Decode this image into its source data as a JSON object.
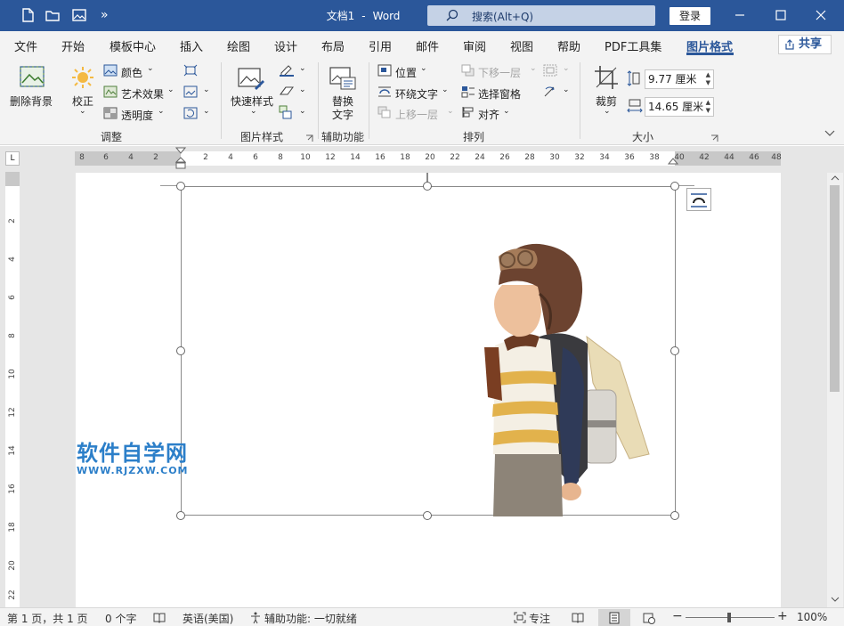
{
  "titlebar": {
    "doc_name": "文档1",
    "separator": "-",
    "app_name": "Word",
    "search_label": "搜索(Alt+Q)",
    "login_label": "登录",
    "qat_more": "»"
  },
  "menu": {
    "tabs": [
      "文件",
      "开始",
      "模板中心",
      "插入",
      "绘图",
      "设计",
      "布局",
      "引用",
      "邮件",
      "审阅",
      "视图",
      "帮助",
      "PDF工具集",
      "图片格式"
    ],
    "active_tab": "图片格式",
    "share_label": "共享"
  },
  "ribbon": {
    "adjust": {
      "remove_bg": "删除背景",
      "correct": "校正",
      "color": "颜色",
      "artistic": "艺术效果",
      "transparency": "透明度",
      "group_label": "调整"
    },
    "styles": {
      "quick_styles": "快速样式",
      "group_label": "图片样式"
    },
    "accessibility": {
      "alt_text_line1": "替换",
      "alt_text_line2": "文字",
      "group_label": "辅助功能"
    },
    "arrange": {
      "position": "位置",
      "wrap_text": "环绕文字",
      "bring_forward": "上移一层",
      "send_backward": "下移一层",
      "selection_pane": "选择窗格",
      "align": "对齐",
      "group_label": "排列"
    },
    "size": {
      "crop": "裁剪",
      "height": "9.77 厘米",
      "width": "14.65 厘米",
      "group_label": "大小"
    }
  },
  "ruler": {
    "h_numbers": [
      "8",
      "6",
      "4",
      "2",
      "",
      "2",
      "4",
      "6",
      "8",
      "10",
      "12",
      "14",
      "16",
      "18",
      "20",
      "22",
      "24",
      "26",
      "28",
      "30",
      "32",
      "34",
      "36",
      "38",
      "40",
      "42",
      "44",
      "46",
      "48"
    ],
    "v_numbers": [
      "2",
      "4",
      "6",
      "8",
      "10",
      "12",
      "14",
      "16",
      "18",
      "20",
      "22"
    ],
    "corner": "L"
  },
  "watermark": {
    "title": "软件自学网",
    "url": "WWW.RJZXW.COM"
  },
  "statusbar": {
    "pages": "第 1 页，共 1 页",
    "words": "0 个字",
    "language": "英语(美国)",
    "accessibility": "辅助功能: 一切就绪",
    "focus": "专注",
    "zoom_minus": "−",
    "zoom_plus": "+",
    "zoom": "100%"
  },
  "colors": {
    "title_bar": "#2b579a",
    "watermark": "#2c7fc9"
  }
}
